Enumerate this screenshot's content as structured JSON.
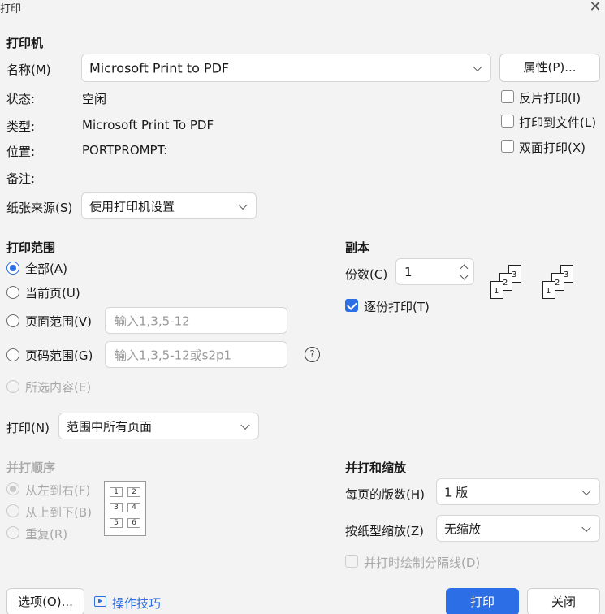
{
  "window": {
    "title": "打印",
    "close_glyph": "✕"
  },
  "printer": {
    "section": "打印机",
    "name_label": "名称(M)",
    "name_value": "Microsoft Print to PDF",
    "properties_button": "属性(P)...",
    "status_label": "状态:",
    "status_value": "空闲",
    "type_label": "类型:",
    "type_value": "Microsoft Print To PDF",
    "location_label": "位置:",
    "location_value": "PORTPROMPT:",
    "comment_label": "备注:",
    "paper_source_label": "纸张来源(S)",
    "paper_source_value": "使用打印机设置",
    "options": [
      {
        "label": "反片打印(I)",
        "checked": false
      },
      {
        "label": "打印到文件(L)",
        "checked": false
      },
      {
        "label": "双面打印(X)",
        "checked": false
      }
    ]
  },
  "range": {
    "section": "打印范围",
    "all": "全部(A)",
    "current": "当前页(U)",
    "pages": "页面范围(V)",
    "pages_placeholder": "输入1,3,5-12",
    "page_numbers": "页码范围(G)",
    "page_numbers_placeholder": "输入1,3,5-12或s2p1",
    "help_glyph": "?",
    "selection": "所选内容(E)",
    "print_label": "打印(N)",
    "print_value": "范围中所有页面"
  },
  "copies": {
    "section": "副本",
    "count_label": "份数(C)",
    "count_value": "1",
    "collate_label": "逐份打印(T)",
    "collate_checked": true,
    "sheet_numbers": [
      "1",
      "2",
      "3"
    ]
  },
  "order": {
    "section": "并打顺序",
    "left_to_right": "从左到右(F)",
    "top_to_bottom": "从上到下(B)",
    "repeat": "重复(R)",
    "grid": [
      "1",
      "2",
      "3",
      "4",
      "5",
      "6"
    ]
  },
  "zoom": {
    "section": "并打和缩放",
    "pages_per_sheet_label": "每页的版数(H)",
    "pages_per_sheet_value": "1 版",
    "scale_label": "按纸型缩放(Z)",
    "scale_value": "无缩放",
    "draw_separator_label": "并打时绘制分隔线(D)"
  },
  "footer": {
    "options_button": "选项(O)...",
    "tips_link": "操作技巧",
    "print_button": "打印",
    "close_button": "关闭"
  },
  "colors": {
    "accent": "#2b6ee6"
  }
}
